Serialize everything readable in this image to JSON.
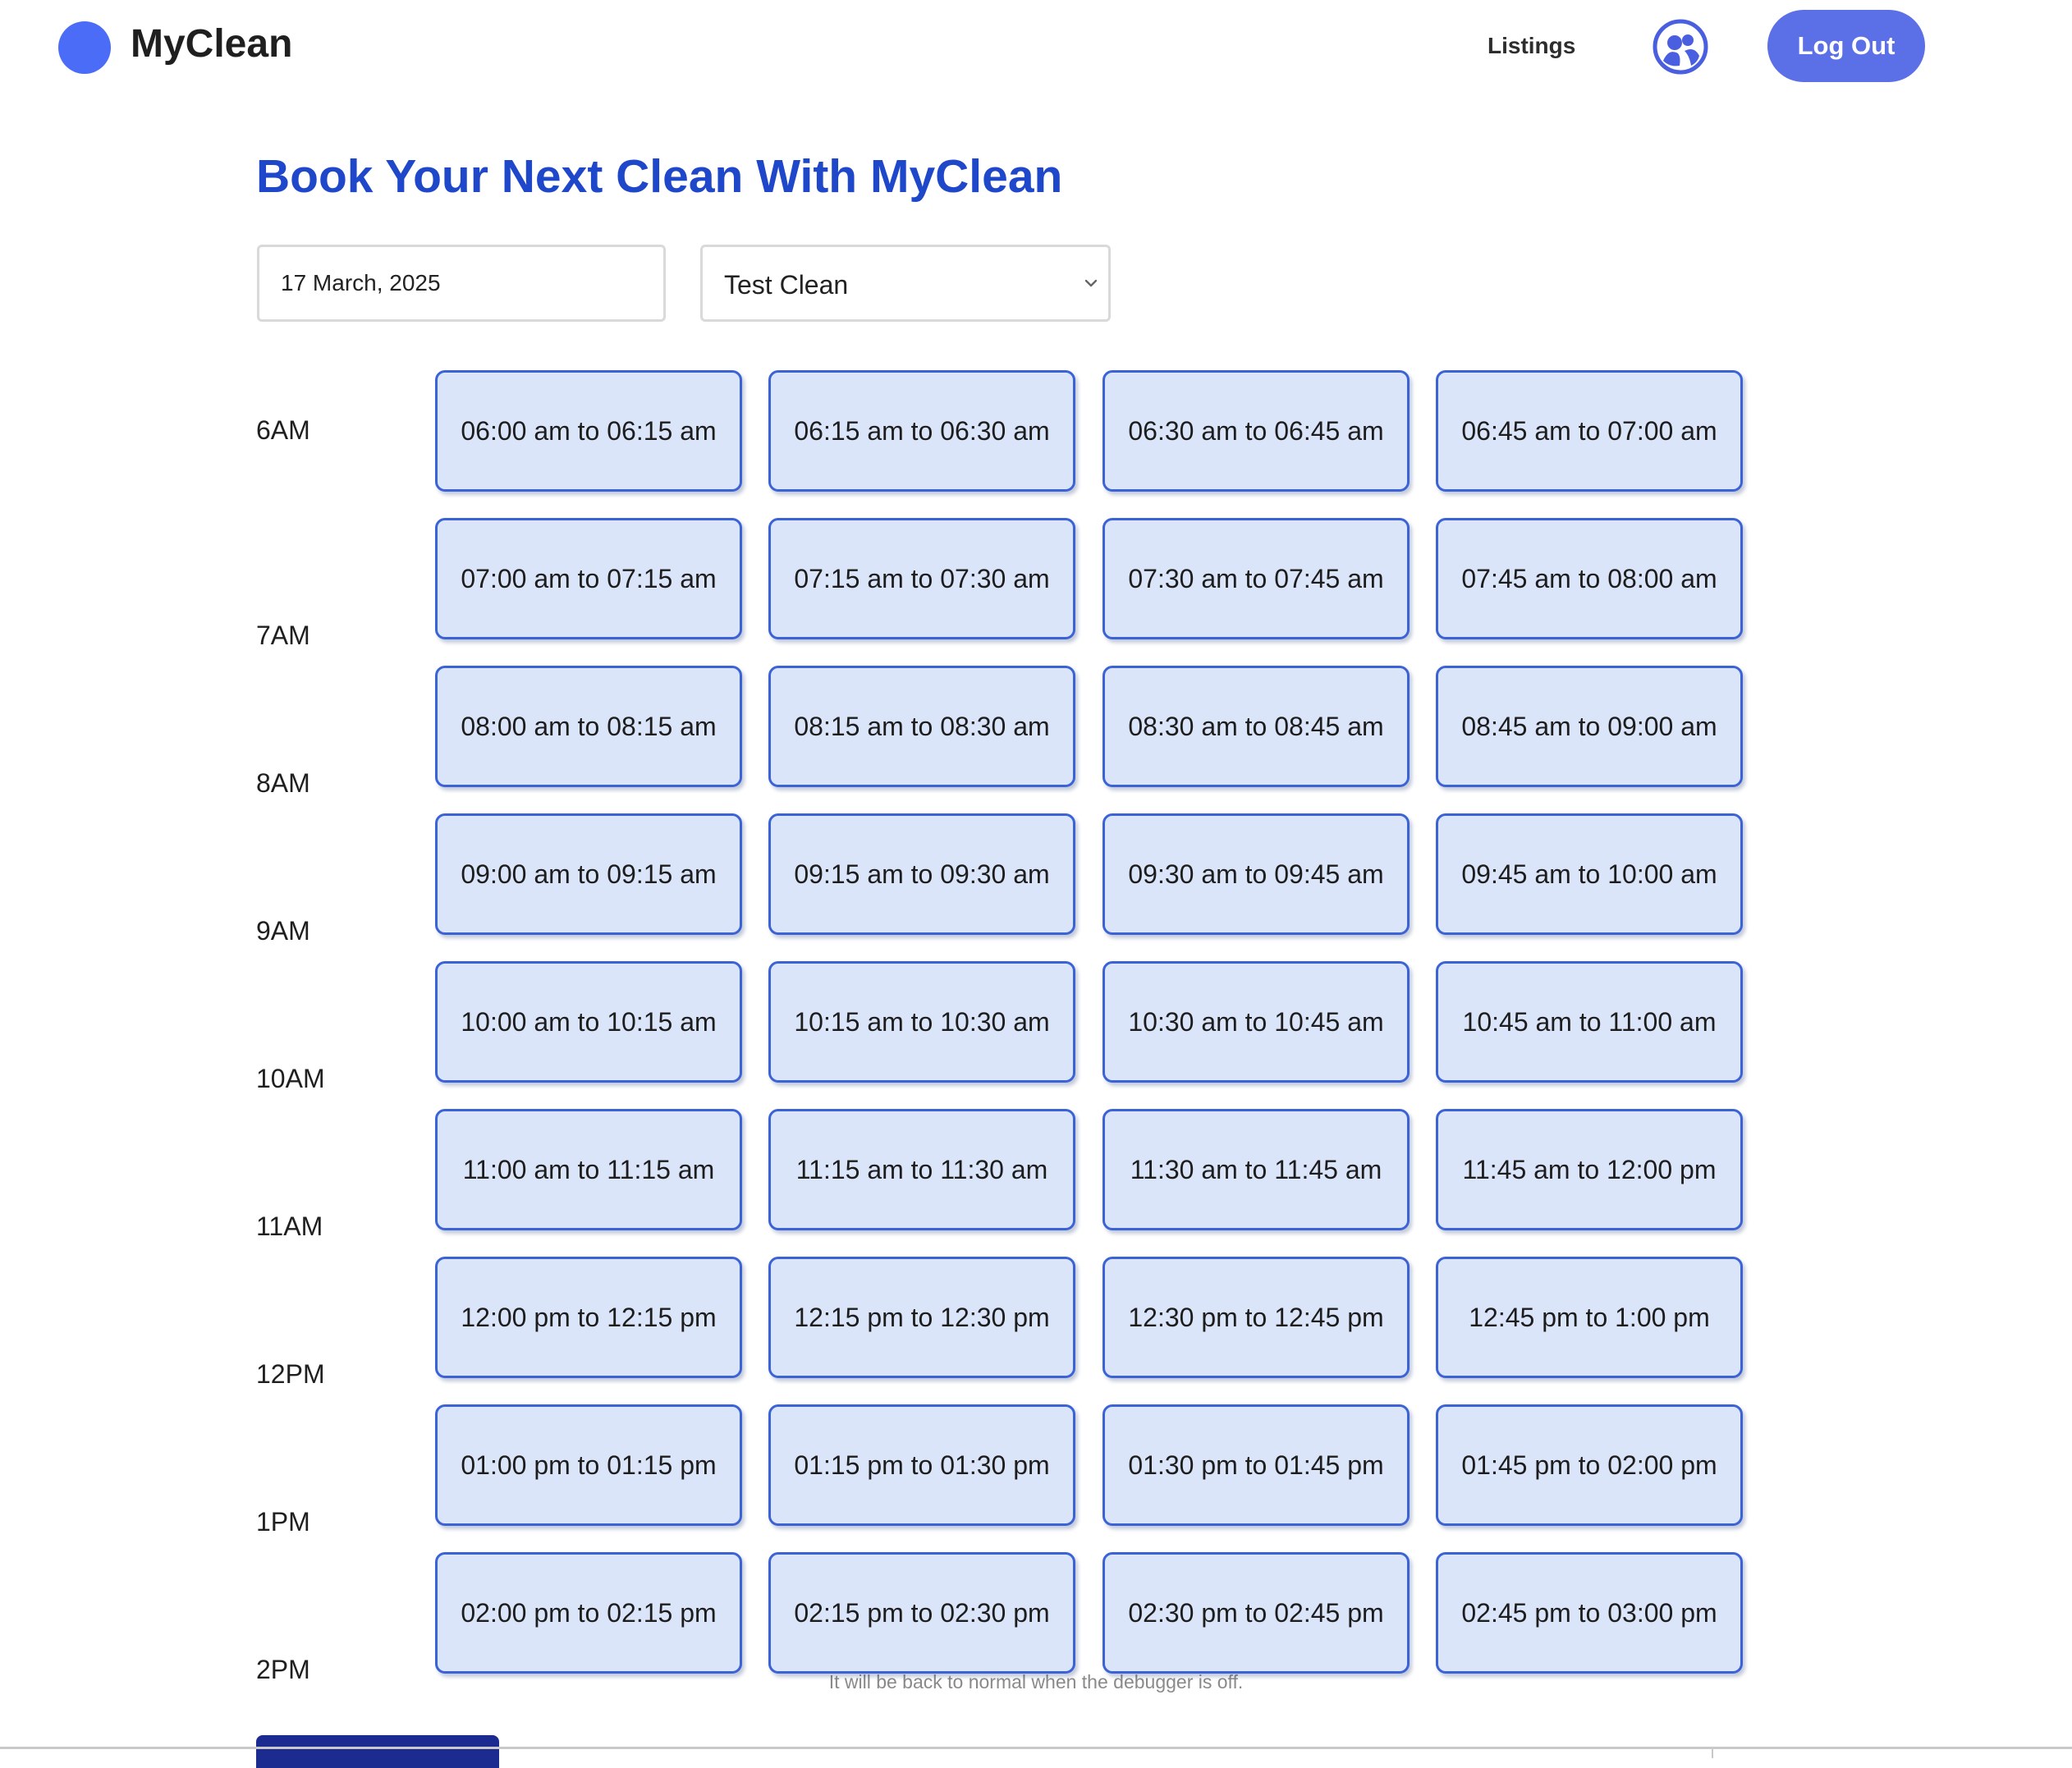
{
  "header": {
    "brand": "MyClean",
    "nav_listings": "Listings",
    "logout_label": "Log Out",
    "brand_color": "#4a6cf7",
    "button_color": "#5b6fe6"
  },
  "main": {
    "title": "Book Your Next Clean With MyClean",
    "date_value": "17 March, 2025",
    "service_selected": "Test Clean",
    "title_color": "#1e47c9"
  },
  "slots": {
    "hours": [
      {
        "label": "6AM",
        "slots": [
          "06:00 am to 06:15 am",
          "06:15 am to 06:30 am",
          "06:30 am to 06:45 am",
          "06:45 am to 07:00 am"
        ]
      },
      {
        "label": "7AM",
        "slots": [
          "07:00 am to 07:15 am",
          "07:15 am to 07:30 am",
          "07:30 am to 07:45 am",
          "07:45 am to 08:00 am"
        ]
      },
      {
        "label": "8AM",
        "slots": [
          "08:00 am to 08:15 am",
          "08:15 am to 08:30 am",
          "08:30 am to 08:45 am",
          "08:45 am to 09:00 am"
        ]
      },
      {
        "label": "9AM",
        "slots": [
          "09:00 am to 09:15 am",
          "09:15 am to 09:30 am",
          "09:30 am to 09:45 am",
          "09:45 am to 10:00 am"
        ]
      },
      {
        "label": "10AM",
        "slots": [
          "10:00 am to 10:15 am",
          "10:15 am to 10:30 am",
          "10:30 am to 10:45 am",
          "10:45 am to 11:00 am"
        ]
      },
      {
        "label": "11AM",
        "slots": [
          "11:00 am to 11:15 am",
          "11:15 am to 11:30 am",
          "11:30 am to 11:45 am",
          "11:45 am to 12:00 pm"
        ]
      },
      {
        "label": "12PM",
        "slots": [
          "12:00 pm to 12:15 pm",
          "12:15 pm to 12:30 pm",
          "12:30 pm to 12:45 pm",
          "12:45 pm to 1:00 pm"
        ]
      },
      {
        "label": "1PM",
        "slots": [
          "01:00 pm to 01:15 pm",
          "01:15 pm to 01:30 pm",
          "01:30 pm to 01:45 pm",
          "01:45 pm to 02:00 pm"
        ]
      },
      {
        "label": "2PM",
        "slots": [
          "02:00 pm to 02:15 pm",
          "02:15 pm to 02:30 pm",
          "02:30 pm to 02:45 pm",
          "02:45 pm to 03:00 pm"
        ]
      }
    ],
    "slot_bg": "#dbe5fa",
    "slot_border": "#3b63d6"
  },
  "footer": {
    "debug_note": "It will be back to normal when the debugger is off."
  },
  "icons": {
    "brand": "circle-logo-icon",
    "profile": "profile-icon",
    "select": "chevron-down-icon"
  }
}
